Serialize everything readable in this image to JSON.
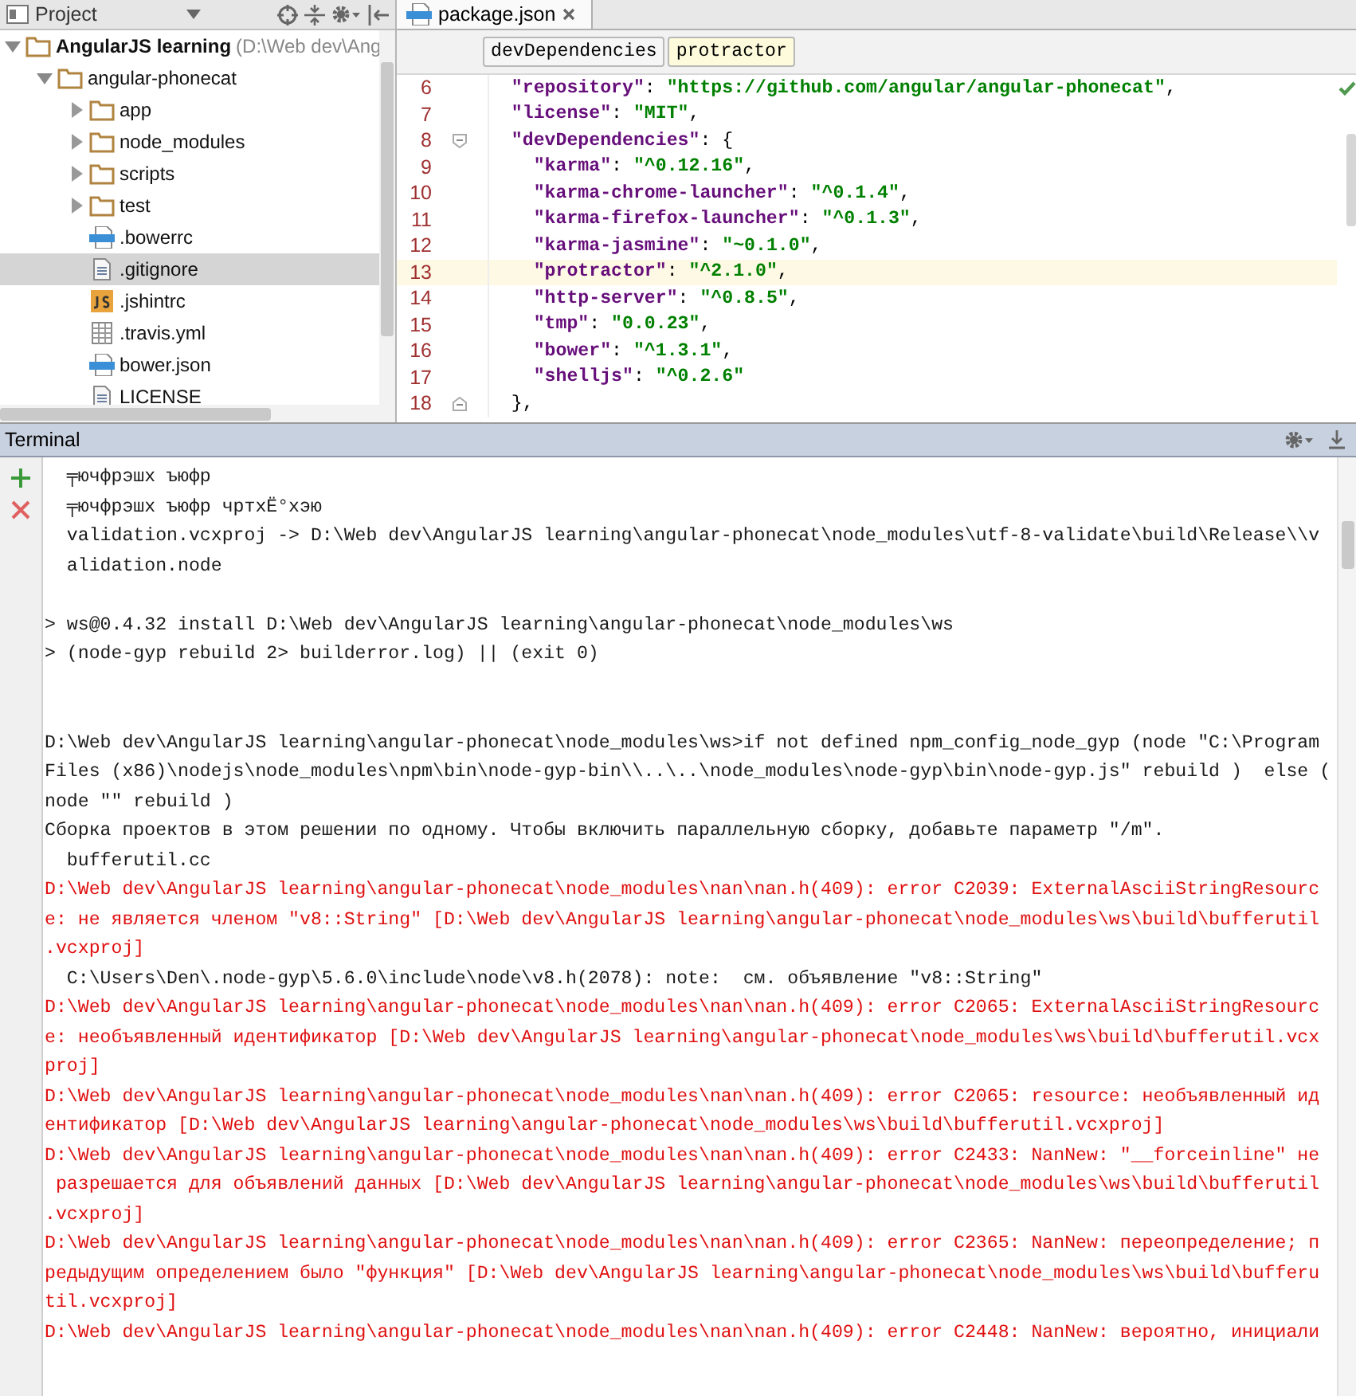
{
  "project_panel": {
    "title": "Project",
    "tree": [
      {
        "label": "AngularJS learning",
        "path": "(D:\\Web dev\\Ang",
        "kind": "folder",
        "expanded": true,
        "selected": false,
        "children": [
          {
            "label": "angular-phonecat",
            "kind": "folder",
            "expanded": true,
            "selected": false,
            "children": [
              {
                "label": "app",
                "kind": "folder",
                "expanded": false,
                "selected": false
              },
              {
                "label": "node_modules",
                "kind": "folder",
                "expanded": false,
                "selected": false
              },
              {
                "label": "scripts",
                "kind": "folder",
                "expanded": false,
                "selected": false
              },
              {
                "label": "test",
                "kind": "folder",
                "expanded": false,
                "selected": false
              },
              {
                "label": ".bowerrc",
                "kind": "json",
                "selected": false
              },
              {
                "label": ".gitignore",
                "kind": "text",
                "selected": true
              },
              {
                "label": ".jshintrc",
                "kind": "js",
                "selected": false
              },
              {
                "label": ".travis.yml",
                "kind": "table",
                "selected": false
              },
              {
                "label": "bower.json",
                "kind": "json",
                "selected": false
              },
              {
                "label": "LICENSE",
                "kind": "text",
                "selected": false
              }
            ]
          }
        ]
      }
    ]
  },
  "editor": {
    "tabs": [
      {
        "label": "package.json",
        "selected": true
      }
    ],
    "breadcrumbs": [
      {
        "label": "devDependencies",
        "selected": false
      },
      {
        "label": "protractor",
        "selected": true
      }
    ],
    "lines": [
      {
        "number": "6",
        "current": false,
        "parts": [
          {
            "kind": "key",
            "text": "  \"repository\""
          },
          {
            "kind": "plain",
            "text": ": "
          },
          {
            "kind": "string",
            "text": "\"https://github.com/angular/angular-phonecat\""
          },
          {
            "kind": "plain",
            "text": ","
          }
        ]
      },
      {
        "number": "7",
        "current": false,
        "parts": [
          {
            "kind": "key",
            "text": "  \"license\""
          },
          {
            "kind": "plain",
            "text": ": "
          },
          {
            "kind": "string",
            "text": "\"MIT\""
          },
          {
            "kind": "plain",
            "text": ","
          }
        ]
      },
      {
        "number": "8",
        "current": false,
        "fold_start": true,
        "parts": [
          {
            "kind": "key",
            "text": "  \"devDependencies\""
          },
          {
            "kind": "plain",
            "text": ": {"
          }
        ]
      },
      {
        "number": "9",
        "current": false,
        "parts": [
          {
            "kind": "key",
            "text": "    \"karma\""
          },
          {
            "kind": "plain",
            "text": ": "
          },
          {
            "kind": "string",
            "text": "\"^0.12.16\""
          },
          {
            "kind": "plain",
            "text": ","
          }
        ]
      },
      {
        "number": "10",
        "current": false,
        "parts": [
          {
            "kind": "key",
            "text": "    \"karma-chrome-launcher\""
          },
          {
            "kind": "plain",
            "text": ": "
          },
          {
            "kind": "string",
            "text": "\"^0.1.4\""
          },
          {
            "kind": "plain",
            "text": ","
          }
        ]
      },
      {
        "number": "11",
        "current": false,
        "parts": [
          {
            "kind": "key",
            "text": "    \"karma-firefox-launcher\""
          },
          {
            "kind": "plain",
            "text": ": "
          },
          {
            "kind": "string",
            "text": "\"^0.1.3\""
          },
          {
            "kind": "plain",
            "text": ","
          }
        ]
      },
      {
        "number": "12",
        "current": false,
        "parts": [
          {
            "kind": "key",
            "text": "    \"karma-jasmine\""
          },
          {
            "kind": "plain",
            "text": ": "
          },
          {
            "kind": "string",
            "text": "\"~0.1.0\""
          },
          {
            "kind": "plain",
            "text": ","
          }
        ]
      },
      {
        "number": "13",
        "current": true,
        "parts": [
          {
            "kind": "key",
            "text": "    \"protractor\""
          },
          {
            "kind": "plain",
            "text": ": "
          },
          {
            "kind": "string",
            "text": "\"^2.1.0\""
          },
          {
            "kind": "plain",
            "text": ","
          }
        ]
      },
      {
        "number": "14",
        "current": false,
        "parts": [
          {
            "kind": "key",
            "text": "    \"http-server\""
          },
          {
            "kind": "plain",
            "text": ": "
          },
          {
            "kind": "string",
            "text": "\"^0.8.5\""
          },
          {
            "kind": "plain",
            "text": ","
          }
        ]
      },
      {
        "number": "15",
        "current": false,
        "parts": [
          {
            "kind": "key",
            "text": "    \"tmp\""
          },
          {
            "kind": "plain",
            "text": ": "
          },
          {
            "kind": "string",
            "text": "\"0.0.23\""
          },
          {
            "kind": "plain",
            "text": ","
          }
        ]
      },
      {
        "number": "16",
        "current": false,
        "parts": [
          {
            "kind": "key",
            "text": "    \"bower\""
          },
          {
            "kind": "plain",
            "text": ": "
          },
          {
            "kind": "string",
            "text": "\"^1.3.1\""
          },
          {
            "kind": "plain",
            "text": ","
          }
        ]
      },
      {
        "number": "17",
        "current": false,
        "parts": [
          {
            "kind": "key",
            "text": "    \"shelljs\""
          },
          {
            "kind": "plain",
            "text": ": "
          },
          {
            "kind": "string",
            "text": "\"^0.2.6\""
          }
        ]
      },
      {
        "number": "18",
        "current": false,
        "fold_end": true,
        "parts": [
          {
            "kind": "plain",
            "text": "  },"
          }
        ]
      }
    ]
  },
  "terminal": {
    "title": "Terminal",
    "lines": [
      {
        "kind": "normal",
        "text": "  ╤ючфрэшх ъюфр"
      },
      {
        "kind": "normal",
        "text": "  ╤ючфрэшх ъюфр чртхЁ°хэю"
      },
      {
        "kind": "normal",
        "text": "  validation.vcxproj -> D:\\Web dev\\AngularJS learning\\angular-phonecat\\node_modules\\utf-8-validate\\build\\Release\\\\v"
      },
      {
        "kind": "normal",
        "text": "  alidation.node"
      },
      {
        "kind": "blank"
      },
      {
        "kind": "normal",
        "text": "> ws@0.4.32 install D:\\Web dev\\AngularJS learning\\angular-phonecat\\node_modules\\ws"
      },
      {
        "kind": "normal",
        "text": "> (node-gyp rebuild 2> builderror.log) || (exit 0)"
      },
      {
        "kind": "blank"
      },
      {
        "kind": "blank"
      },
      {
        "kind": "normal",
        "text": "D:\\Web dev\\AngularJS learning\\angular-phonecat\\node_modules\\ws>if not defined npm_config_node_gyp (node \"C:\\Program"
      },
      {
        "kind": "normal",
        "text": "Files (x86)\\nodejs\\node_modules\\npm\\bin\\node-gyp-bin\\\\..\\..\\node_modules\\node-gyp\\bin\\node-gyp.js\" rebuild )  else ("
      },
      {
        "kind": "normal",
        "text": "node \"\" rebuild )"
      },
      {
        "kind": "normal",
        "text": "Сборка проектов в этом решении по одному. Чтобы включить параллельную сборку, добавьте параметр \"/m\"."
      },
      {
        "kind": "normal",
        "text": "  bufferutil.cc"
      },
      {
        "kind": "error",
        "text": "D:\\Web dev\\AngularJS learning\\angular-phonecat\\node_modules\\nan\\nan.h(409): error C2039: ExternalAsciiStringResourc"
      },
      {
        "kind": "error",
        "text": "e: не является членом \"v8::String\" [D:\\Web dev\\AngularJS learning\\angular-phonecat\\node_modules\\ws\\build\\bufferutil"
      },
      {
        "kind": "error",
        "text": ".vcxproj]"
      },
      {
        "kind": "normal",
        "text": "  C:\\Users\\Den\\.node-gyp\\5.6.0\\include\\node\\v8.h(2078): note:  см. объявление \"v8::String\""
      },
      {
        "kind": "error",
        "text": "D:\\Web dev\\AngularJS learning\\angular-phonecat\\node_modules\\nan\\nan.h(409): error C2065: ExternalAsciiStringResourc"
      },
      {
        "kind": "error",
        "text": "e: необъявленный идентификатор [D:\\Web dev\\AngularJS learning\\angular-phonecat\\node_modules\\ws\\build\\bufferutil.vcx"
      },
      {
        "kind": "error",
        "text": "proj]"
      },
      {
        "kind": "error",
        "text": "D:\\Web dev\\AngularJS learning\\angular-phonecat\\node_modules\\nan\\nan.h(409): error C2065: resource: необъявленный ид"
      },
      {
        "kind": "error",
        "text": "ентификатор [D:\\Web dev\\AngularJS learning\\angular-phonecat\\node_modules\\ws\\build\\bufferutil.vcxproj]"
      },
      {
        "kind": "error",
        "text": "D:\\Web dev\\AngularJS learning\\angular-phonecat\\node_modules\\nan\\nan.h(409): error C2433: NanNew: \"__forceinline\" не"
      },
      {
        "kind": "error",
        "text": " разрешается для объявлений данных [D:\\Web dev\\AngularJS learning\\angular-phonecat\\node_modules\\ws\\build\\bufferutil"
      },
      {
        "kind": "error",
        "text": ".vcxproj]"
      },
      {
        "kind": "error",
        "text": "D:\\Web dev\\AngularJS learning\\angular-phonecat\\node_modules\\nan\\nan.h(409): error C2365: NanNew: переопределение; п"
      },
      {
        "kind": "error",
        "text": "редыдущим определением было \"функция\" [D:\\Web dev\\AngularJS learning\\angular-phonecat\\node_modules\\ws\\build\\bufferu"
      },
      {
        "kind": "error",
        "text": "til.vcxproj]"
      },
      {
        "kind": "error",
        "text": "D:\\Web dev\\AngularJS learning\\angular-phonecat\\node_modules\\nan\\nan.h(409): error C2448: NanNew: вероятно, инициали"
      }
    ]
  }
}
